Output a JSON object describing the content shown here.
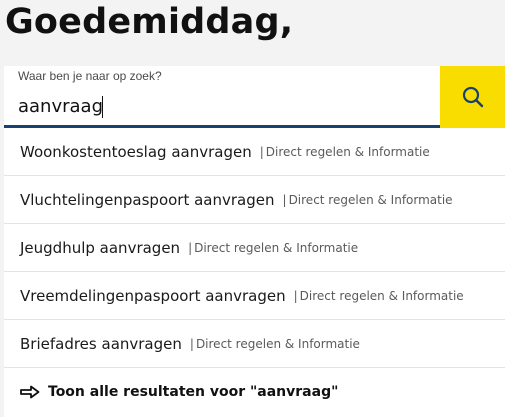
{
  "header": {
    "greeting": "Goedemiddag,"
  },
  "search": {
    "label": "Waar ben je naar op zoek?",
    "value": "aanvraag",
    "button_icon": "search-icon",
    "accent_color": "#f9dc00",
    "underline_color": "#154273"
  },
  "results": {
    "items": [
      {
        "title": "Woonkostentoeslag aanvragen",
        "separator": "|",
        "category": "Direct regelen & Informatie"
      },
      {
        "title": "Vluchtelingenpaspoort aanvragen",
        "separator": "|",
        "category": "Direct regelen & Informatie"
      },
      {
        "title": "Jeugdhulp aanvragen",
        "separator": "|",
        "category": "Direct regelen & Informatie"
      },
      {
        "title": "Vreemdelingenpaspoort aanvragen",
        "separator": "|",
        "category": "Direct regelen & Informatie"
      },
      {
        "title": "Briefadres aanvragen",
        "separator": "|",
        "category": "Direct regelen & Informatie"
      }
    ],
    "show_all": {
      "icon": "arrow-right-icon",
      "label": "Toon alle resultaten voor \"aanvraag\""
    }
  }
}
